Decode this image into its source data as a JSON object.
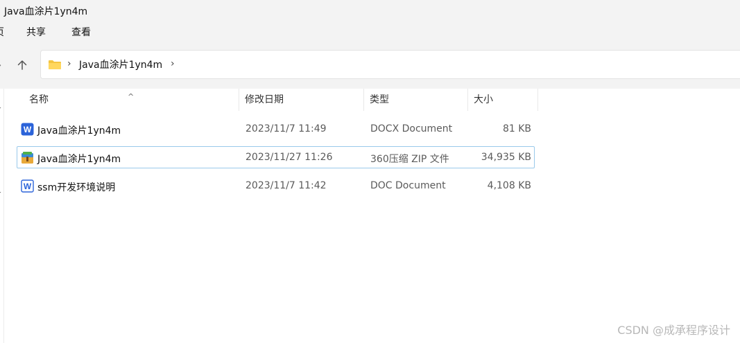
{
  "window": {
    "title": "Java血涂片1yn4m"
  },
  "menu": {
    "clipped_label": "页",
    "share_label": "共享",
    "view_label": "查看"
  },
  "navigation": {
    "up_icon": "arrow-up-icon",
    "clipped_arrow": "›"
  },
  "address_bar": {
    "folder_icon": "folder-icon",
    "crumb": "Java血涂片1yn4m",
    "chevron": "›"
  },
  "columns": {
    "name": "名称",
    "date": "修改日期",
    "type": "类型",
    "size": "大小",
    "sort_indicator": "^"
  },
  "files": [
    {
      "name": "Java血涂片1yn4m",
      "date": "2023/11/7 11:49",
      "type": "DOCX Document",
      "size": "81 KB",
      "icon": "word-docx-icon"
    },
    {
      "name": "Java血涂片1yn4m",
      "date": "2023/11/27 11:26",
      "type": "360压缩 ZIP 文件",
      "size": "34,935 KB",
      "icon": "zip-archive-icon",
      "focused": true
    },
    {
      "name": "ssm开发环境说明",
      "date": "2023/11/7 11:42",
      "type": "DOC Document",
      "size": "4,108 KB",
      "icon": "word-doc-icon"
    }
  ],
  "watermark": "CSDN @成承程序设计",
  "colors": {
    "chrome_bg": "#f3f3f3",
    "folder": "#f4c542",
    "word_blue": "#2b63d9",
    "focus_border": "#99c9ea"
  }
}
